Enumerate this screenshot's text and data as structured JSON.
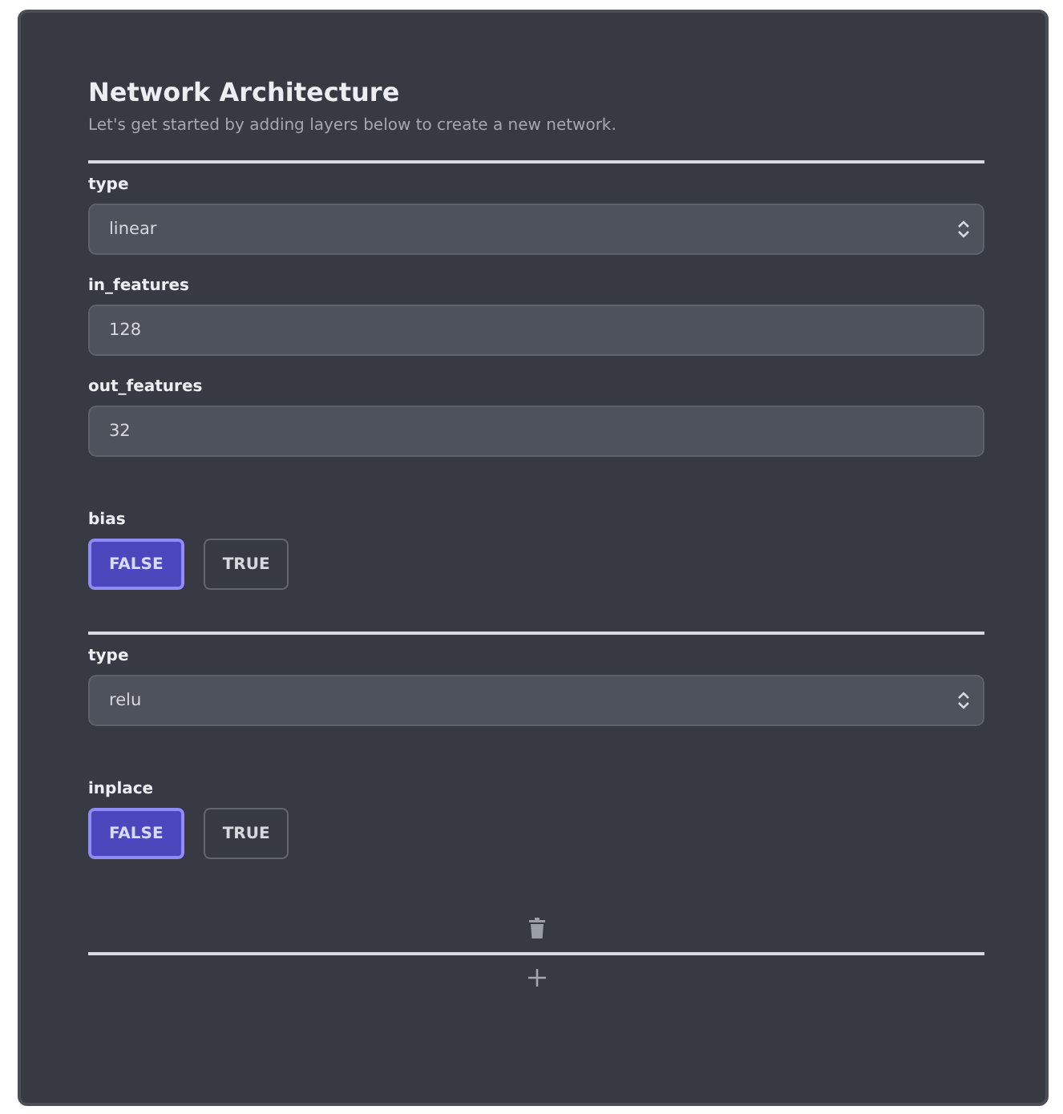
{
  "header": {
    "title": "Network Architecture",
    "subtitle": "Let's get started by adding layers below to create a new network."
  },
  "layers": [
    {
      "fields": [
        {
          "kind": "select",
          "label": "type",
          "value": "linear"
        },
        {
          "kind": "number",
          "label": "in_features",
          "value": "128"
        },
        {
          "kind": "number",
          "label": "out_features",
          "value": "32"
        },
        {
          "kind": "boolean",
          "label": "bias",
          "options": [
            {
              "label": "FALSE",
              "selected": true
            },
            {
              "label": "TRUE",
              "selected": false
            }
          ]
        }
      ]
    },
    {
      "fields": [
        {
          "kind": "select",
          "label": "type",
          "value": "relu"
        },
        {
          "kind": "boolean",
          "label": "inplace",
          "options": [
            {
              "label": "FALSE",
              "selected": true
            },
            {
              "label": "TRUE",
              "selected": false
            }
          ]
        }
      ]
    }
  ]
}
